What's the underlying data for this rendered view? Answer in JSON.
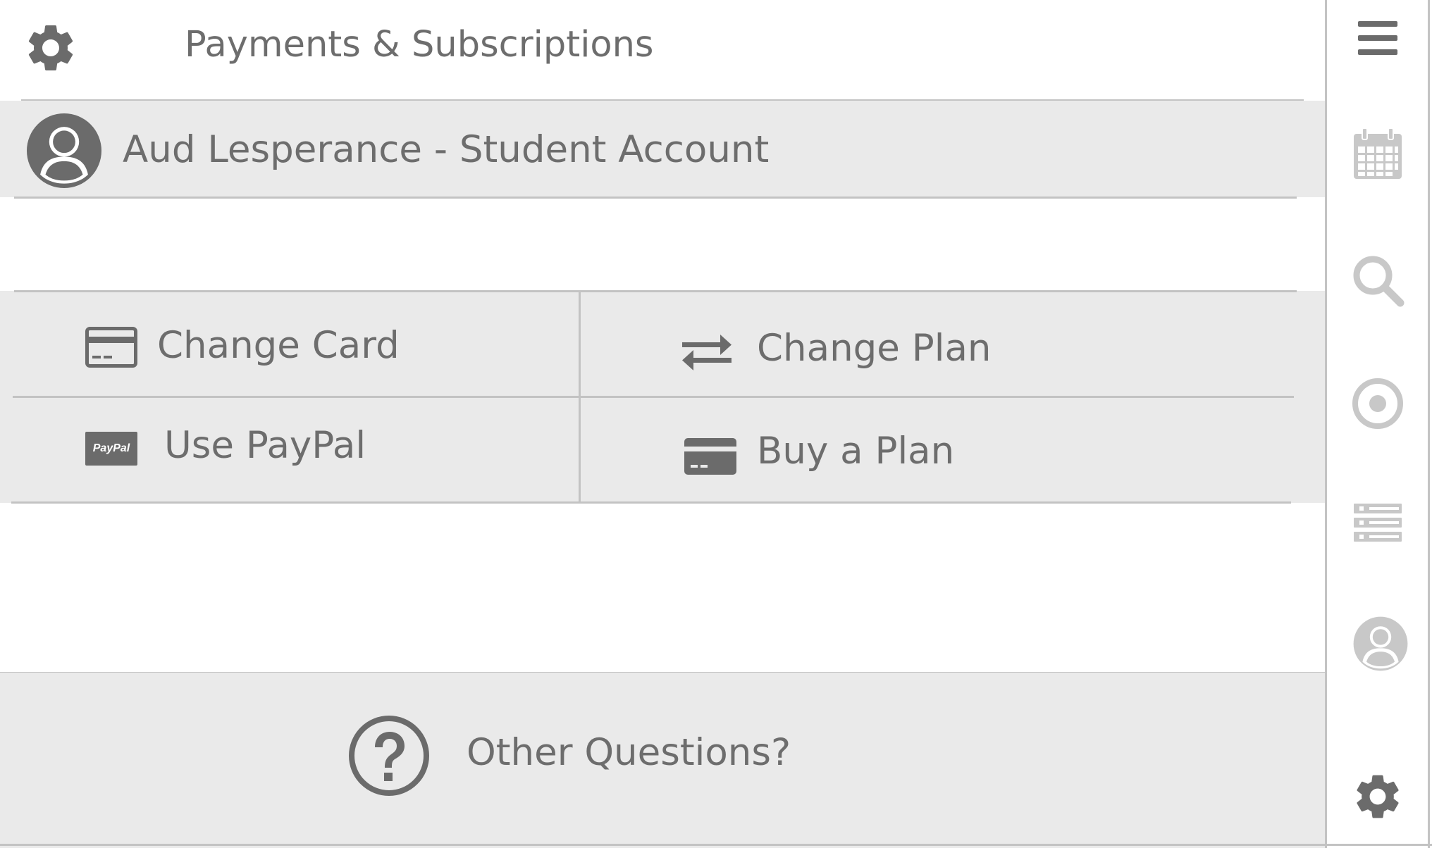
{
  "header": {
    "title": "Payments & Subscriptions",
    "settings_icon": "gear-icon"
  },
  "account": {
    "name": "Aud Lesperance - Student Account",
    "avatar_icon": "user-avatar-icon"
  },
  "options": [
    {
      "label": "Change Card",
      "icon": "credit-card-icon"
    },
    {
      "label": "Change Plan",
      "icon": "swap-arrows-icon"
    },
    {
      "label": "Use PayPal",
      "icon": "paypal-icon",
      "icon_text": "PayPal"
    },
    {
      "label": "Buy a Plan",
      "icon": "credit-card-filled-icon"
    }
  ],
  "help": {
    "label": "Other Questions?",
    "icon": "question-circle-icon"
  },
  "sidebar": {
    "items": [
      {
        "icon": "menu-icon"
      },
      {
        "icon": "calendar-icon"
      },
      {
        "icon": "search-icon"
      },
      {
        "icon": "target-icon"
      },
      {
        "icon": "list-icon"
      },
      {
        "icon": "user-icon"
      },
      {
        "icon": "gear-icon"
      }
    ]
  },
  "colors": {
    "background": "#ffffff",
    "band": "#eaeaea",
    "divider": "#c3c3c3",
    "text": "#6d6d6d",
    "icon_dark": "#6b6b6b",
    "icon_light": "#c8c8c8"
  }
}
